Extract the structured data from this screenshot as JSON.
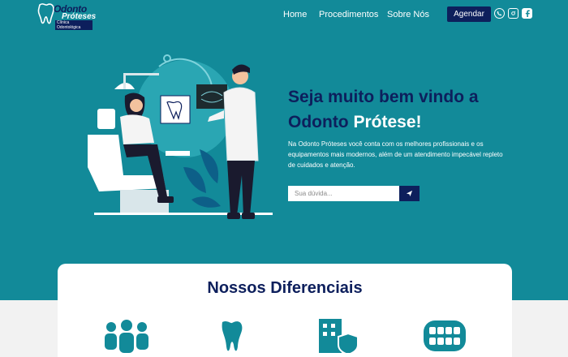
{
  "header": {
    "logo": {
      "line1": "Odonto",
      "line2": "Próteses",
      "line3": "Clínica Odontológica"
    },
    "nav": [
      {
        "label": "Home"
      },
      {
        "label": "Procedimentos"
      },
      {
        "label": "Sobre Nós"
      }
    ],
    "cta_label": "Agendar",
    "social": [
      "whatsapp-icon",
      "instagram-icon",
      "facebook-icon"
    ]
  },
  "hero": {
    "title_line1": "Seja muito bem vindo a",
    "title_line2_a": "Odonto",
    "title_line2_b": "Prótese!",
    "description": "Na Odonto Próteses você conta com os melhores profissionais e os equipamentos mais modernos, além de um atendimento impecável repleto de cuidados e atenção.",
    "search_placeholder": "Sua dúvida..."
  },
  "features": {
    "title": "Nossos Diferenciais",
    "icons": [
      "team-icon",
      "tooth-icon",
      "building-shield-icon",
      "teeth-icon"
    ]
  },
  "colors": {
    "primary": "#128a99",
    "navy": "#0d1f5c",
    "white": "#ffffff"
  }
}
